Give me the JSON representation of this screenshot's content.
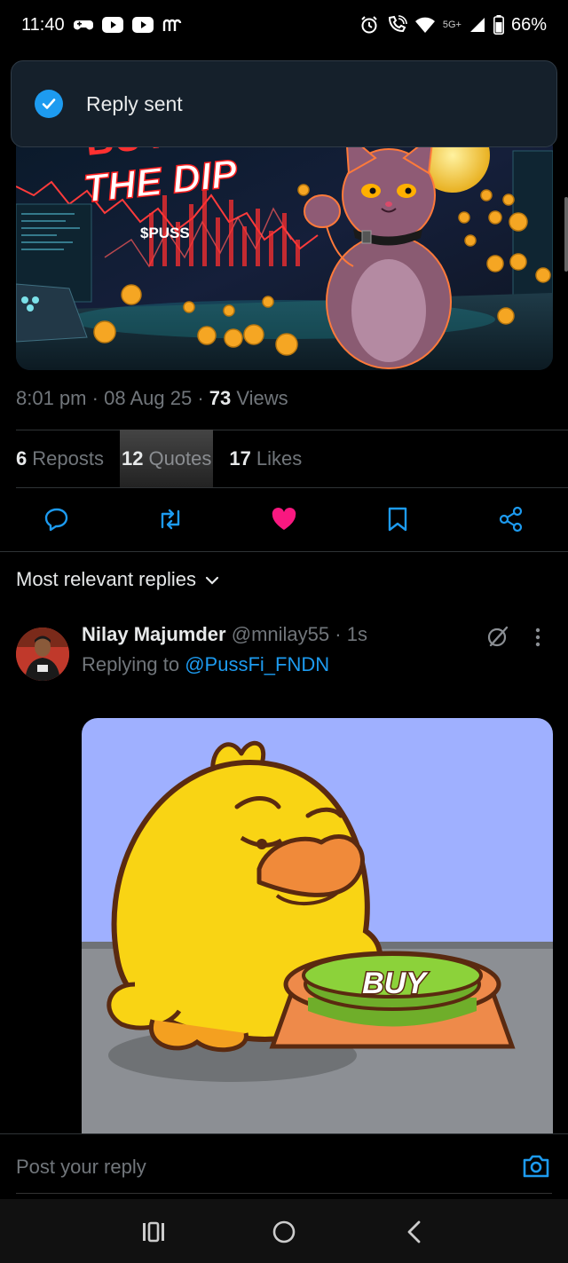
{
  "status_bar": {
    "time": "11:40",
    "network": "5G+",
    "battery": "66%"
  },
  "toast": {
    "text": "Reply sent"
  },
  "post": {
    "media_alt": "Buy the dip $PUSS cat image",
    "media_text": {
      "headline_top": "BUY IT",
      "headline": "THE DIP",
      "ticker": "$PUSS"
    },
    "time": "8:01 pm",
    "date": "08 Aug 25",
    "views_count": "73",
    "views_label": "Views",
    "reposts_count": "6",
    "reposts_label": "Reposts",
    "quotes_count": "12",
    "quotes_label": "Quotes",
    "likes_count": "17",
    "likes_label": "Likes"
  },
  "replies": {
    "sort_label": "Most relevant replies",
    "items": [
      {
        "name": "Nilay Majumder",
        "handle": "@mnilay55",
        "time": "1s",
        "replying_prefix": "Replying to",
        "replying_to": "@PussFi_FNDN",
        "gif_button_text": "BUY"
      }
    ]
  },
  "compose": {
    "placeholder": "Post your reply"
  },
  "colors": {
    "accent": "#1d9bf0",
    "like": "#f91880",
    "background": "#000000",
    "muted": "#71767b"
  },
  "icons": {
    "reply": "reply-icon",
    "repost": "repost-icon",
    "like": "heart-icon",
    "bookmark": "bookmark-icon",
    "share": "share-icon",
    "camera": "camera-icon",
    "grok": "grok-icon",
    "more": "more-vertical-icon"
  }
}
